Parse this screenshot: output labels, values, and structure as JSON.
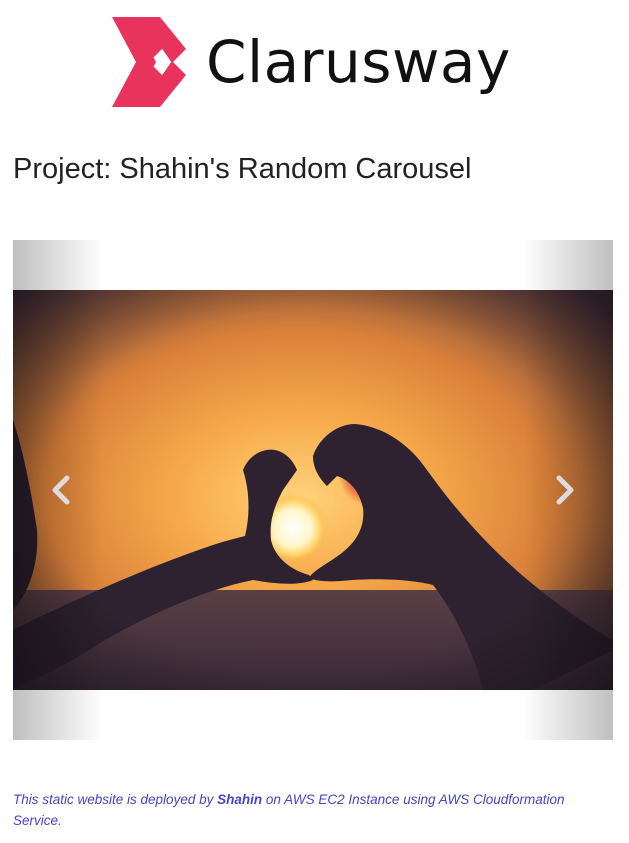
{
  "header": {
    "brand_name": "Clarusway",
    "logo_icon": "clarusway-chevrons-logo",
    "brand_color": "#e8335d"
  },
  "page": {
    "title": "Project: Shahin's Random Carousel"
  },
  "carousel": {
    "image_description": "silhouette of two hands forming a heart around the sun at sunset",
    "prev_icon": "chevron-left-icon",
    "next_icon": "chevron-right-icon"
  },
  "footer": {
    "text_before": "This static website is deployed by ",
    "author": "Shahin",
    "text_after": " on AWS EC2 Instance using AWS Cloudformation Service.",
    "text_color": "#4444cc"
  }
}
